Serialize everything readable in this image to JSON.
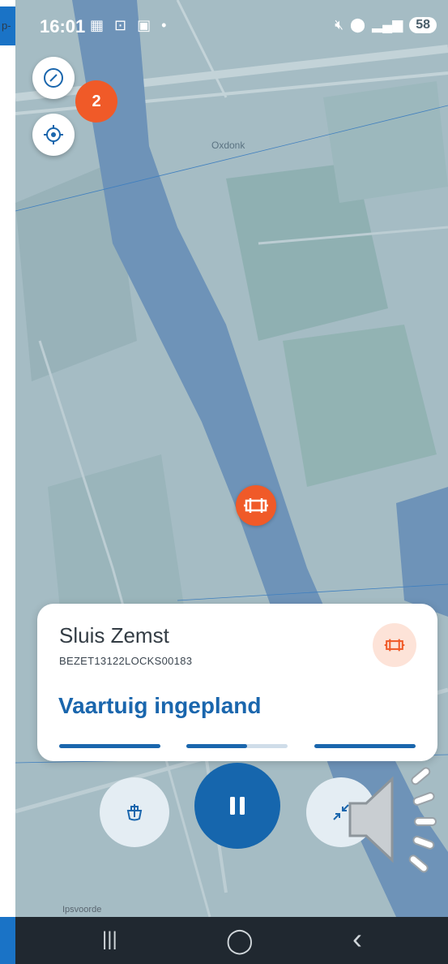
{
  "status_bar": {
    "time": "16:01",
    "left_icons": "▦ ⊡ ▣ •",
    "battery": "58"
  },
  "left_edge": {
    "partial_text": "p-"
  },
  "map": {
    "place_label": "Oxdonk",
    "cluster_count": "2",
    "faded_label": "Ipsvoorde"
  },
  "card": {
    "title": "Sluis Zemst",
    "subtitle": "BEZET13122LOCKS00183",
    "status": "Vaartuig ingepland",
    "progress": [
      1.0,
      0.6,
      1.0
    ]
  },
  "nav": {
    "recent_label": "|||",
    "home_label": "◯",
    "back_label": "‹"
  },
  "colors": {
    "accent": "#1666ad",
    "marker": "#f05a28",
    "water": "#6e93b8"
  }
}
